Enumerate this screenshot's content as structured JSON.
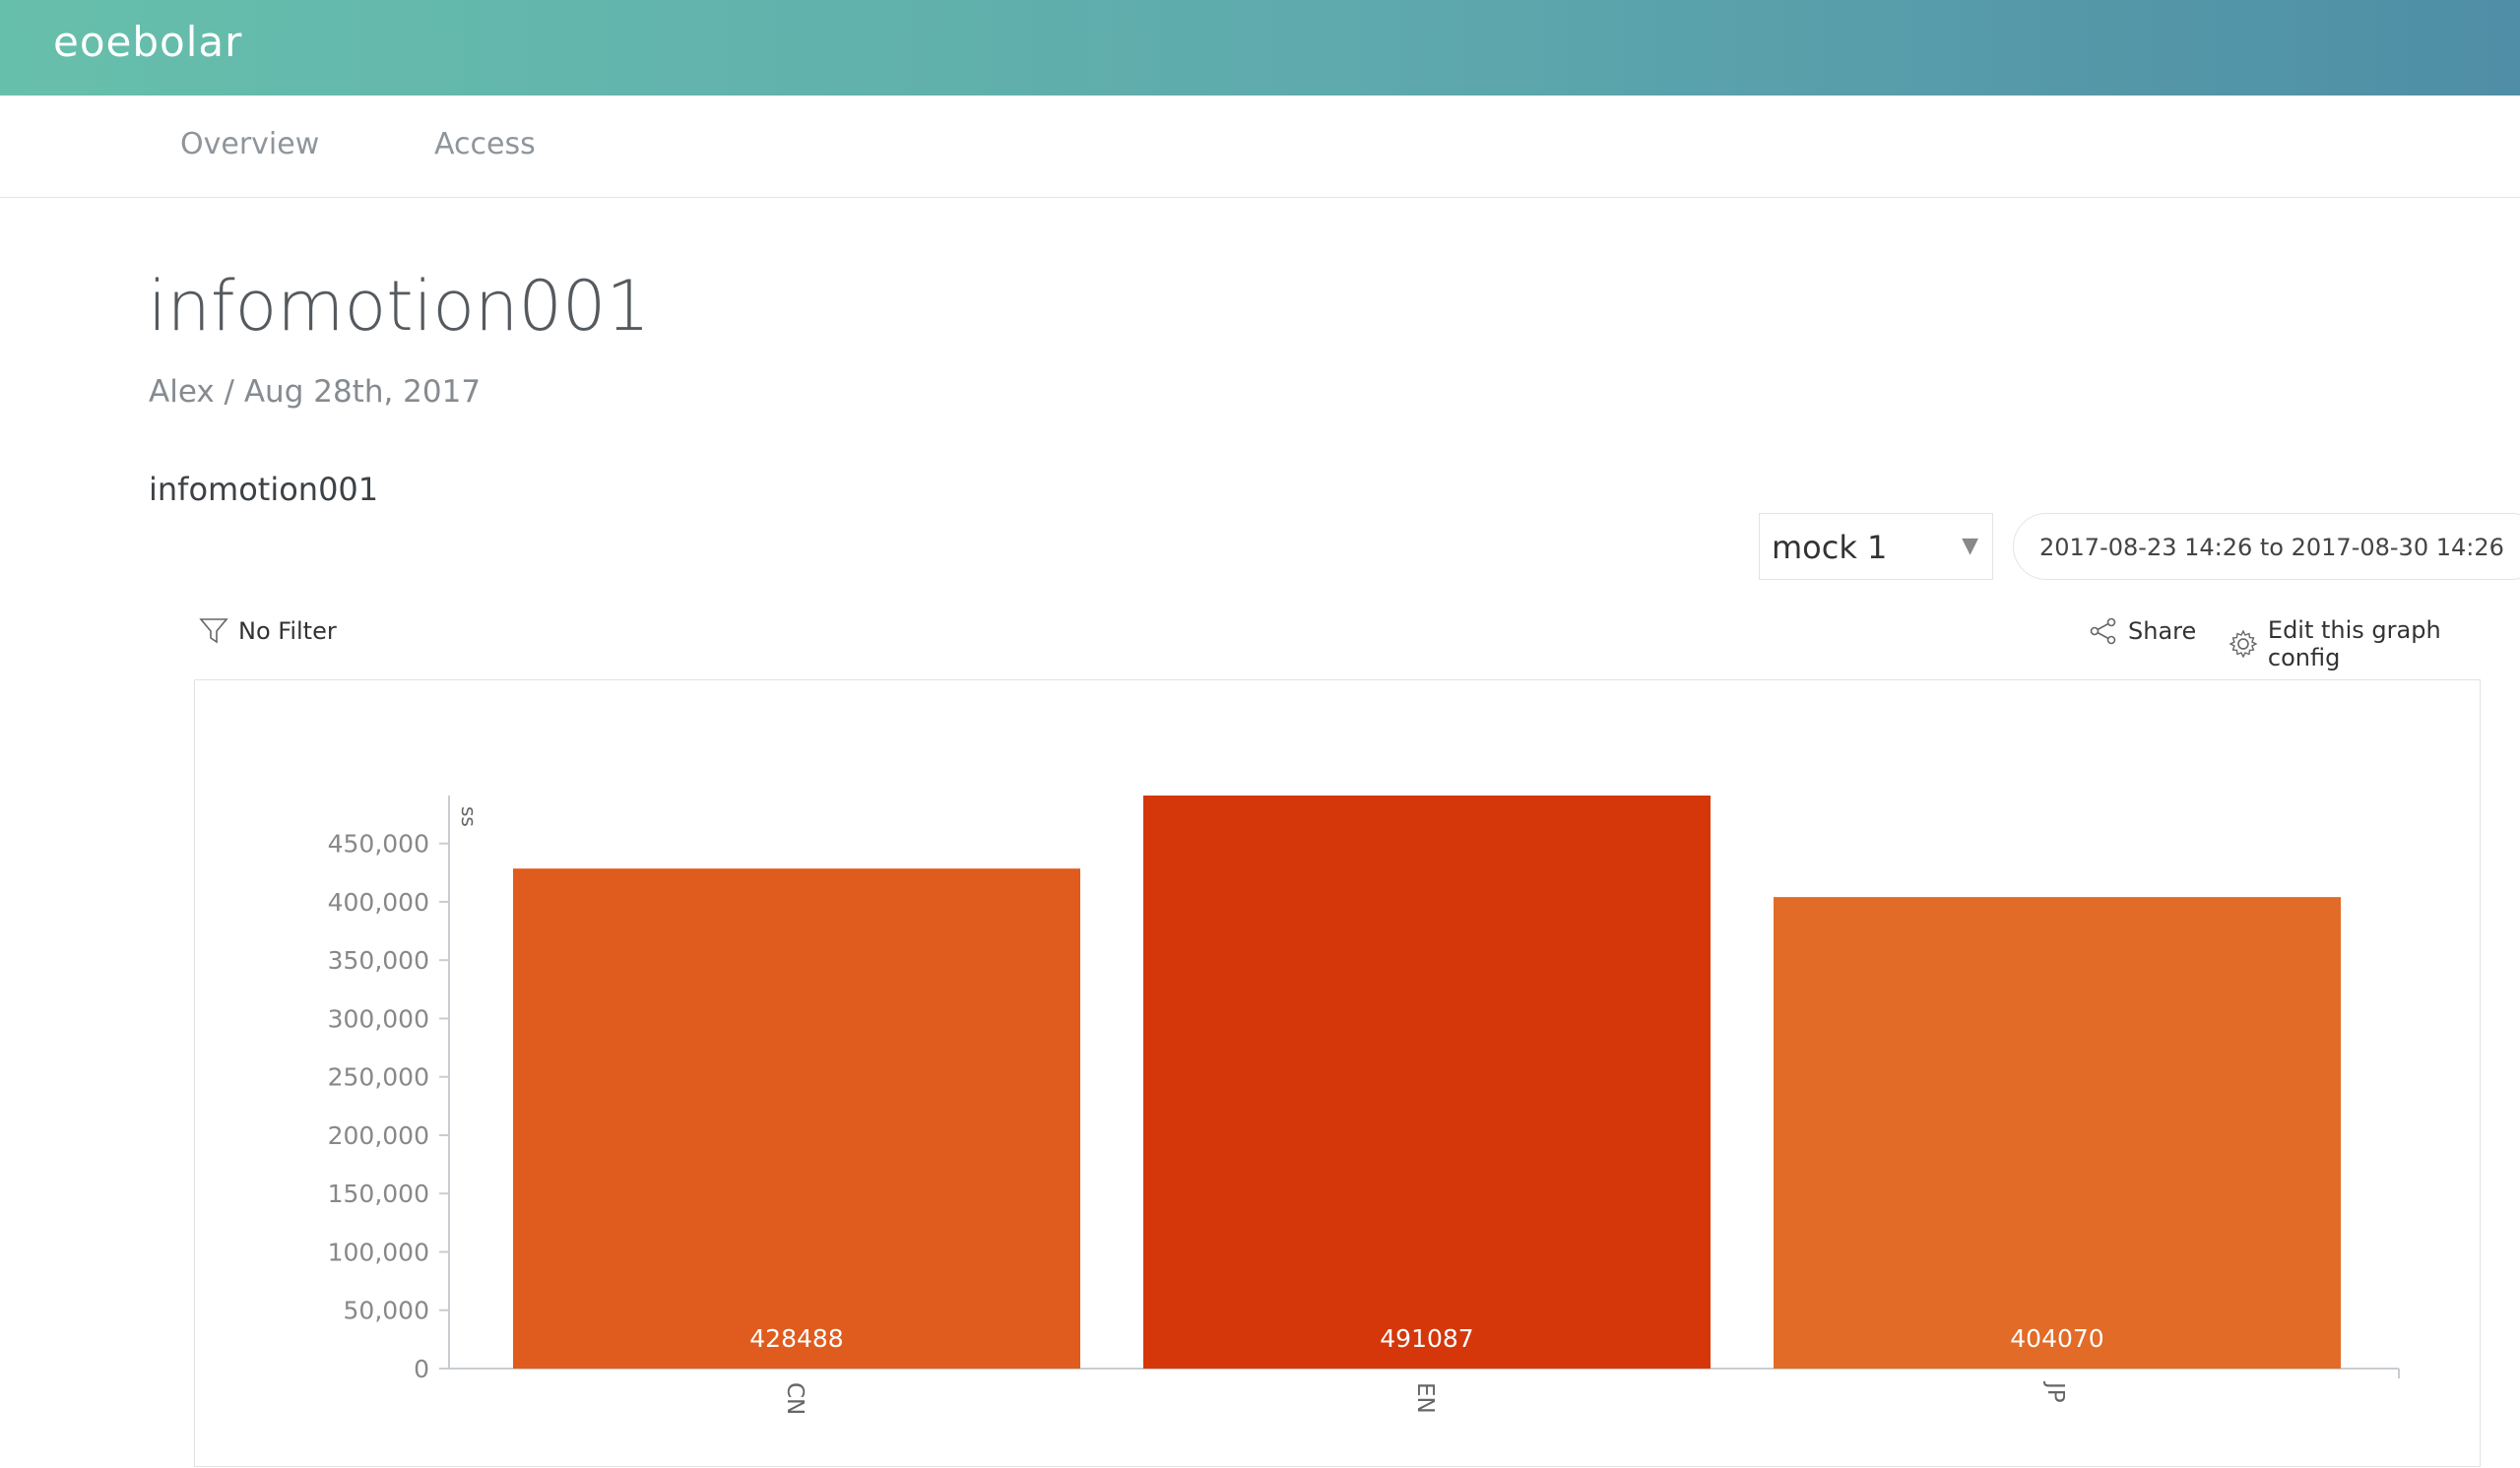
{
  "brand": {
    "logo_text": "eoebolar"
  },
  "nav": {
    "tabs": [
      {
        "label": "Overview"
      },
      {
        "label": "Access"
      }
    ]
  },
  "page": {
    "title": "infomotion001",
    "byline": "Alex / Aug 28th, 2017",
    "graph_name": "infomotion001"
  },
  "controls": {
    "dataset_select": {
      "value": "mock 1"
    },
    "date_range": "2017-08-23 14:26 to 2017-08-30 14:26",
    "filter_label": "No Filter",
    "share_label": "Share",
    "edit_label": "Edit this graph config"
  },
  "icons": {
    "filter": "filter-icon",
    "share": "share-icon",
    "settings": "gear-icon",
    "dropdown": "chevron-down-icon"
  },
  "colors": {
    "header_start": "#66bfab",
    "header_end": "#4f8ea6"
  },
  "chart_data": {
    "type": "bar",
    "ylabel": "ss",
    "categories": [
      "CN",
      "EN",
      "JP"
    ],
    "values": [
      428488,
      491087,
      404070
    ],
    "bar_colors": [
      "#df5c1e",
      "#d5370b",
      "#e26b27"
    ],
    "data_labels": [
      "428488",
      "491087",
      "404070"
    ],
    "yticks": [
      0,
      50000,
      100000,
      150000,
      200000,
      250000,
      300000,
      350000,
      400000,
      450000
    ],
    "ytick_labels": [
      "0",
      "50,000",
      "100,000",
      "150,000",
      "200,000",
      "250,000",
      "300,000",
      "350,000",
      "400,000",
      "450,000"
    ],
    "ylim": [
      0,
      491087
    ],
    "grid": false
  }
}
